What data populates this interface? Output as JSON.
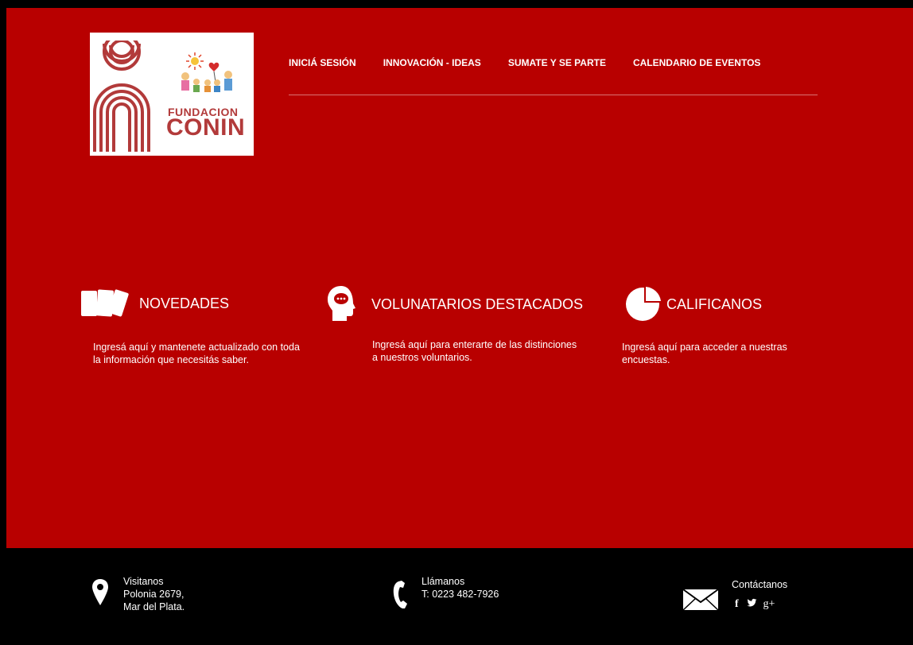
{
  "logo": {
    "line1": "FUNDACION",
    "line2": "CONIN"
  },
  "nav": {
    "items": [
      {
        "label": "INICIÁ SESIÓN"
      },
      {
        "label": "INNOVACIÓN - IDEAS"
      },
      {
        "label": "SUMATE Y SE PARTE"
      },
      {
        "label": "CALENDARIO DE EVENTOS"
      }
    ]
  },
  "features": [
    {
      "icon": "cards-icon",
      "title": "NOVEDADES",
      "description": "Ingresá aquí y mantenete actualizado con toda la información que necesitás saber."
    },
    {
      "icon": "head-chat-icon",
      "title": "VOLUNATARIOS DESTACADOS",
      "description": "Ingresá aquí para enterarte de las distinciones a nuestros voluntarios."
    },
    {
      "icon": "pie-chart-icon",
      "title": "CALIFICANOS",
      "description": "Ingresá aquí para acceder a nuestras encuestas."
    }
  ],
  "footer": {
    "visit": {
      "heading": "Visitanos",
      "line1": "Polonia 2679,",
      "line2": "Mar del Plata."
    },
    "call": {
      "heading": "Llámanos",
      "phone": "T: 0223 482-7926"
    },
    "contact": {
      "heading": "Contáctanos"
    },
    "social": {
      "facebook": "f",
      "twitter": "t",
      "google": "g+"
    }
  },
  "colors": {
    "main_bg": "#b80000",
    "footer_bg": "#000000",
    "logo_red": "#b23a3a"
  }
}
